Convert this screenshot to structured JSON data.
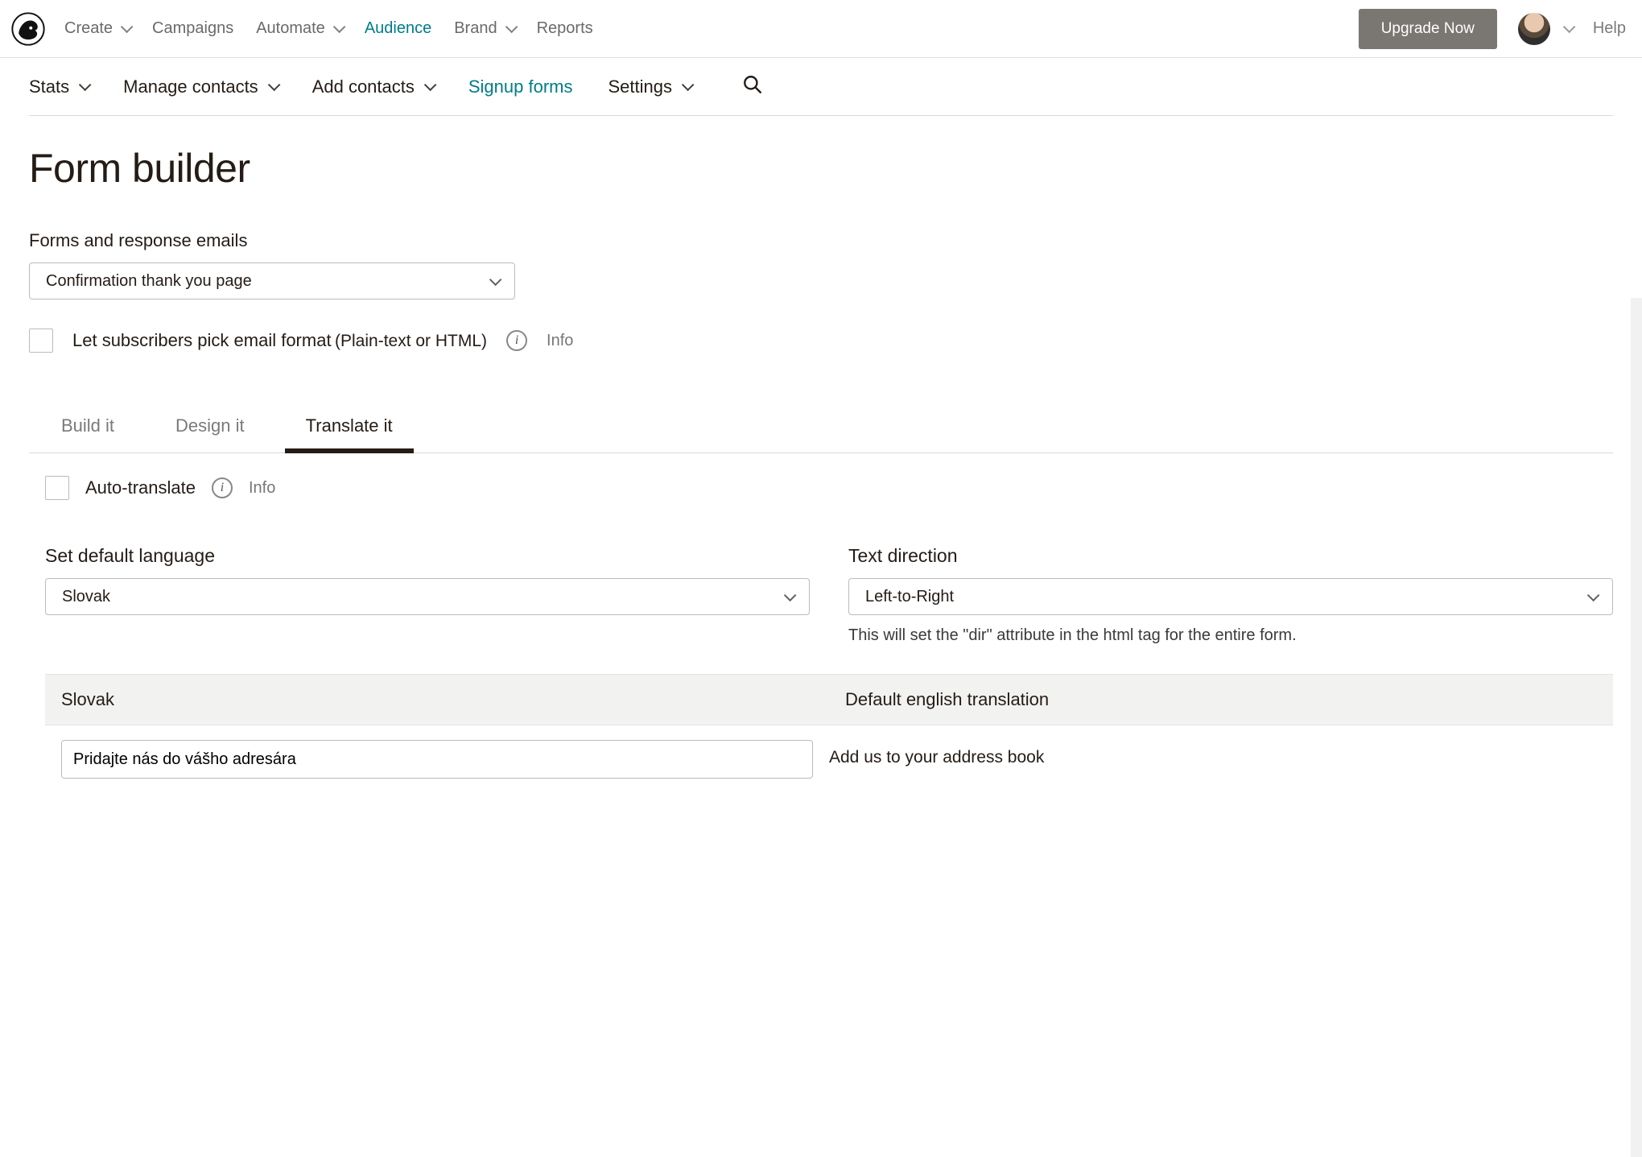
{
  "topnav": {
    "create": "Create",
    "campaigns": "Campaigns",
    "automate": "Automate",
    "audience": "Audience",
    "brand": "Brand",
    "reports": "Reports",
    "upgrade": "Upgrade Now",
    "help": "Help"
  },
  "subnav": {
    "stats": "Stats",
    "manage_contacts": "Manage contacts",
    "add_contacts": "Add contacts",
    "signup_forms": "Signup forms",
    "settings": "Settings"
  },
  "page": {
    "title": "Form builder",
    "forms_label": "Forms and response emails",
    "forms_select_value": "Confirmation thank you page",
    "let_subscribers_label": "Let subscribers pick email format",
    "let_subscribers_sub": "(Plain-text or HTML)",
    "info": "Info"
  },
  "tabs": {
    "build": "Build it",
    "design": "Design it",
    "translate": "Translate it"
  },
  "translate": {
    "auto_translate": "Auto-translate",
    "info": "Info",
    "set_default_language": "Set default language",
    "language_value": "Slovak",
    "text_direction": "Text direction",
    "text_direction_value": "Left-to-Right",
    "text_direction_help": "This will set the \"dir\" attribute in the html tag for the entire form.",
    "table": {
      "col_lang": "Slovak",
      "col_default": "Default english translation",
      "row1_translation": "Pridajte nás do vášho adresára",
      "row1_english": "Add us to your address book"
    }
  }
}
